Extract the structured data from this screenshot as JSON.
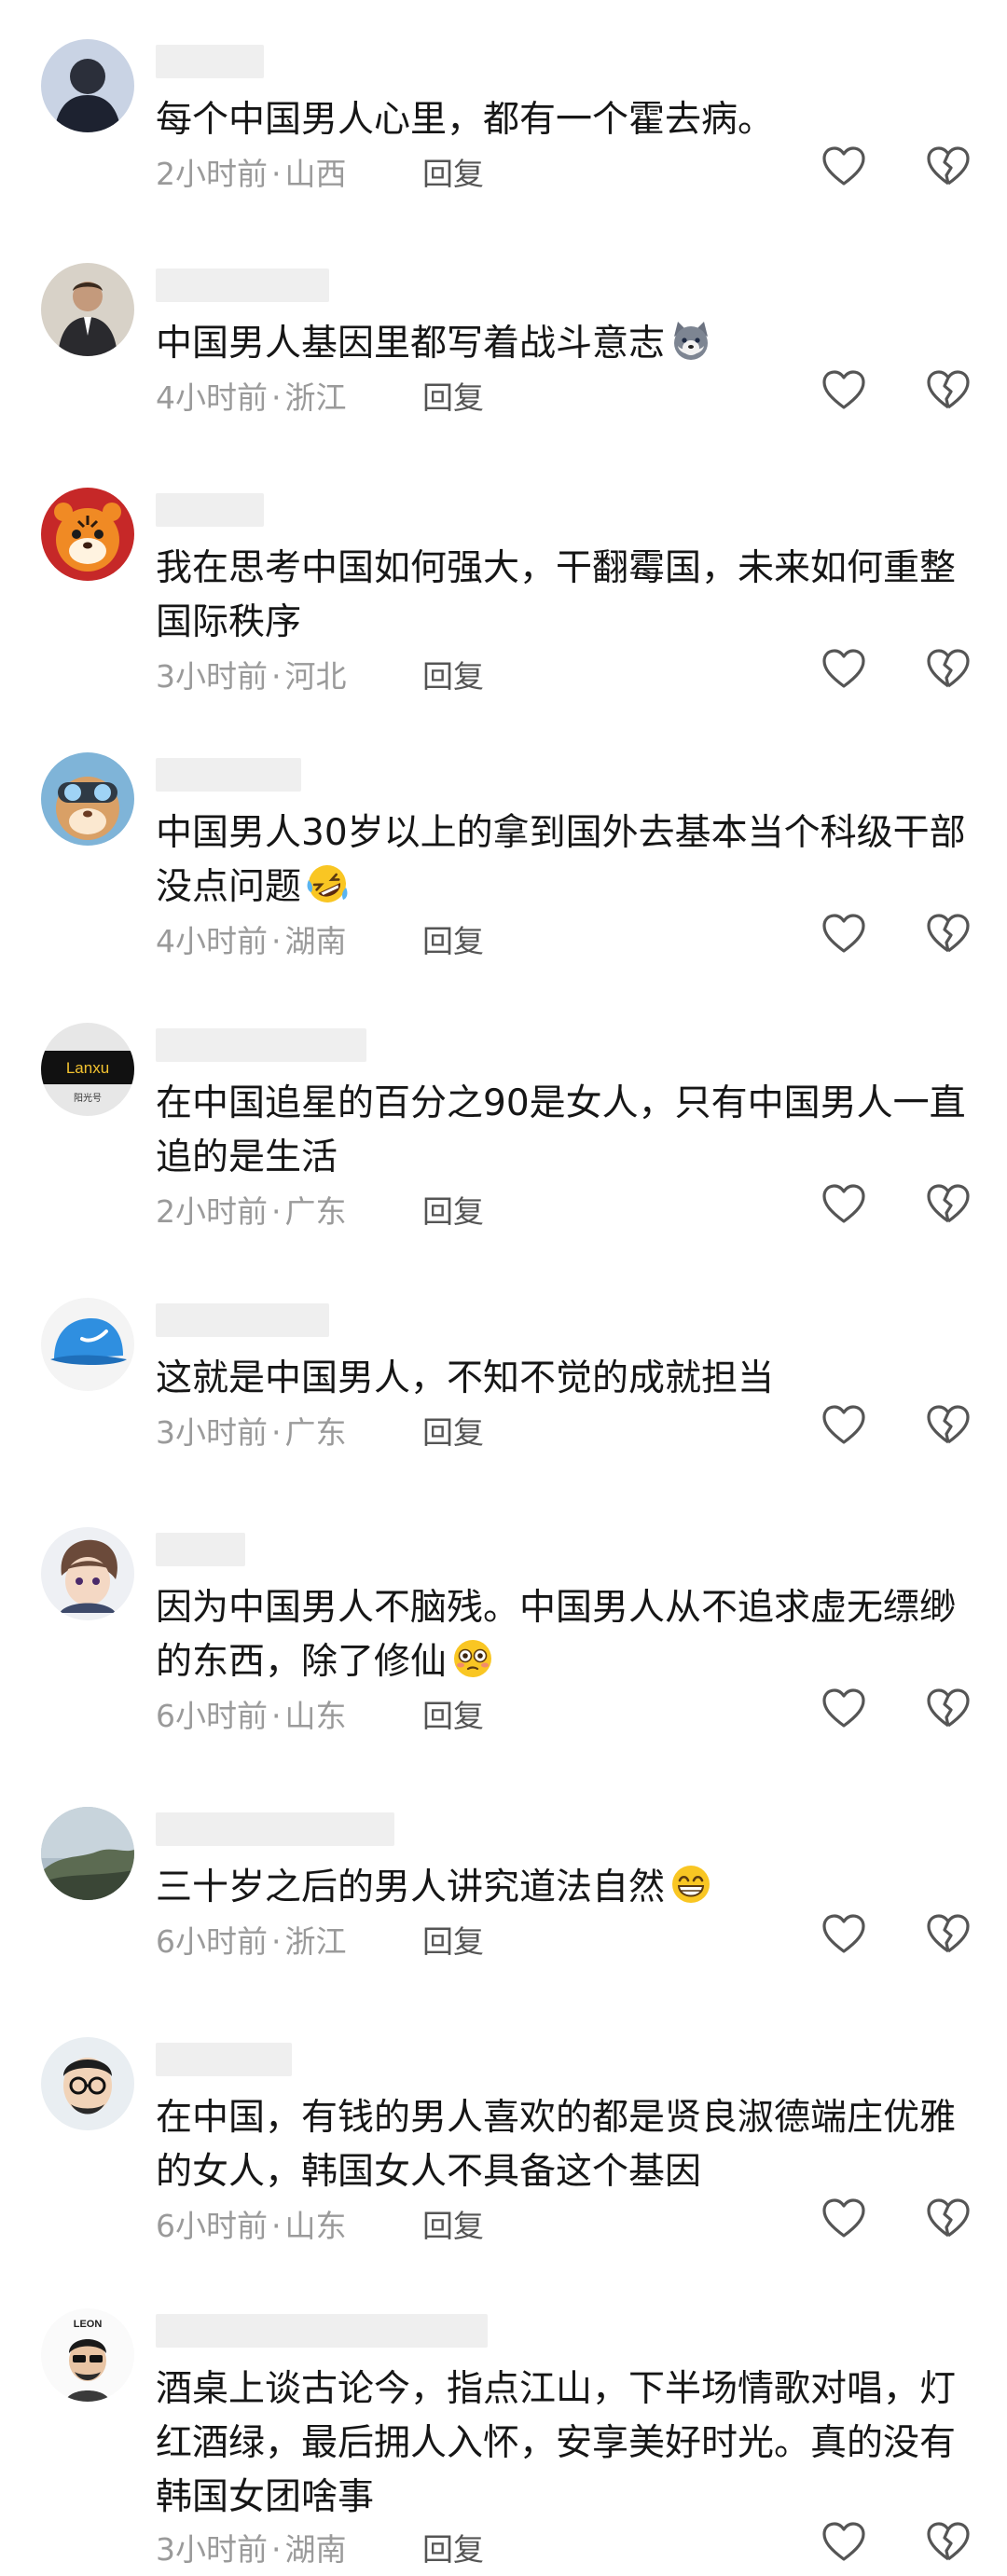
{
  "comments": [
    {
      "text": "每个中国男人心里，都有一个霍去病。",
      "time": "2小时前",
      "location": "山西",
      "reply": "回复",
      "avatar": "avatar-dark-figure"
    },
    {
      "text": "中国男人基因里都写着战斗意志",
      "emoji": "husky-emoji",
      "time": "4小时前",
      "location": "浙江",
      "reply": "回复",
      "avatar": "avatar-man-in-suit"
    },
    {
      "text": "我在思考中国如何强大，干翻霉国，未来如何重整国际秩序",
      "time": "3小时前",
      "location": "河北",
      "reply": "回复",
      "avatar": "avatar-tiger-mascot"
    },
    {
      "text": "中国男人30岁以上的拿到国外去基本当个科级干部没点问题",
      "emoji": "rofl-emoji",
      "time": "4小时前",
      "location": "湖南",
      "reply": "回复",
      "avatar": "avatar-hamster-goggles"
    },
    {
      "text": "在中国追星的百分之90是女人，只有中国男人一直追的是生活",
      "time": "2小时前",
      "location": "广东",
      "reply": "回复",
      "avatar": "avatar-lanxu-logo"
    },
    {
      "text": "这就是中国男人，不知不觉的成就担当",
      "time": "3小时前",
      "location": "广东",
      "reply": "回复",
      "avatar": "avatar-blue-cap"
    },
    {
      "text": "因为中国男人不脑残。中国男人从不追求虚无缥缈的东西，除了修仙",
      "emoji": "flushed-emoji",
      "time": "6小时前",
      "location": "山东",
      "reply": "回复",
      "avatar": "avatar-anime-character"
    },
    {
      "text": "三十岁之后的男人讲究道法自然",
      "emoji": "grin-emoji",
      "time": "6小时前",
      "location": "浙江",
      "reply": "回复",
      "avatar": "avatar-misty-mountain"
    },
    {
      "text": "在中国，有钱的男人喜欢的都是贤良淑德端庄优雅的女人，韩国女人不具备这个基因",
      "time": "6小时前",
      "location": "山东",
      "reply": "回复",
      "avatar": "avatar-man-glasses"
    },
    {
      "text": "酒桌上谈古论今，指点江山，下半场情歌对唱，灯红酒绿，最后拥人入怀，安享美好时光。真的没有韩国女团啥事",
      "time": "3小时前",
      "location": "湖南",
      "reply": "回复",
      "avatar": "avatar-leon-cartoon"
    }
  ],
  "avatar_labels": {
    "lanxu_logo_text": "Lanxu",
    "lanxu_sub_text": "阳光号",
    "leon_text": "LEON"
  },
  "colors": {
    "meta_text": "#9a9a9a",
    "reply_text": "#555555",
    "comment_text": "#161616",
    "username_placeholder": "#efefef"
  }
}
